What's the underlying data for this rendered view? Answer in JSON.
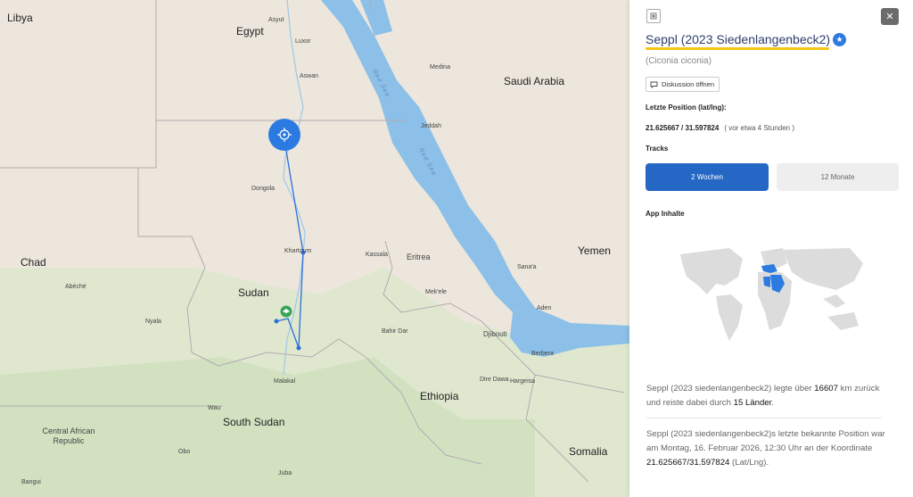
{
  "map": {
    "countries": [
      "Libya",
      "Egypt",
      "Saudi Arabia",
      "Chad",
      "Sudan",
      "Yemen",
      "Eritrea",
      "Ethiopia",
      "South Sudan",
      "Central African Republic",
      "Somalia",
      "Djibouti"
    ],
    "cities": [
      "Asyut",
      "Luxor",
      "Aswan",
      "Medina",
      "Jeddah",
      "Dongola",
      "Khartoum",
      "Kassala",
      "Mek'ele",
      "Sana'a",
      "Aden",
      "Abéché",
      "Nyala",
      "Bahir Dar",
      "Berbera",
      "Hargeisa",
      "Dire Dawa",
      "Malakal",
      "Wau",
      "Obo",
      "Juba",
      "Bangui"
    ],
    "seas": [
      "Red Sea",
      "Red Sea"
    ],
    "track_color": "#2a6fdb",
    "track_points": [
      {
        "lat": 21.63,
        "lng": 31.6
      },
      {
        "lat": 15.6,
        "lng": 32.55
      },
      {
        "lat": 11.2,
        "lng": 32.5
      },
      {
        "lat": 13.1,
        "lng": 31.0
      },
      {
        "lat": 13.6,
        "lng": 31.3
      }
    ]
  },
  "panel": {
    "icon_top_left": "window-icon",
    "close_icon": "close-icon",
    "title": "Seppl (2023 Siedenlangenbeck2)",
    "verified_icon": "star-badge-icon",
    "scientific_name": "(Ciconia ciconia)",
    "discussion_label": "Diskussion öffnen",
    "position_heading": "Letzte Position (lat/lng):",
    "coordinates": "21.625667 / 31.597824",
    "time_ago": "( vor etwa 4 Stunden )",
    "tracks_heading": "Tracks",
    "tracks_buttons": [
      "2 Wochen",
      "12 Monate"
    ],
    "tracks_active": 0,
    "app_heading": "App Inhalte",
    "stat1": {
      "pre": "Seppl (2023 siedenlangenbeck2) legte über ",
      "distance": "16607",
      "mid": " km zurück und reiste dabei durch ",
      "countries": "15 Länder",
      "post": "."
    },
    "stat2": {
      "pre": "Seppl (2023 siedenlangenbeck2)s letzte bekannte Position war am Montag, 16. Februar 2026, 12:30 Uhr an der Koordinate ",
      "coord": "21.625667/31.597824",
      "post": " (Lat/Lng)."
    },
    "accent_blue": "#2467c5",
    "highlight_yellow": "#f6c515"
  }
}
